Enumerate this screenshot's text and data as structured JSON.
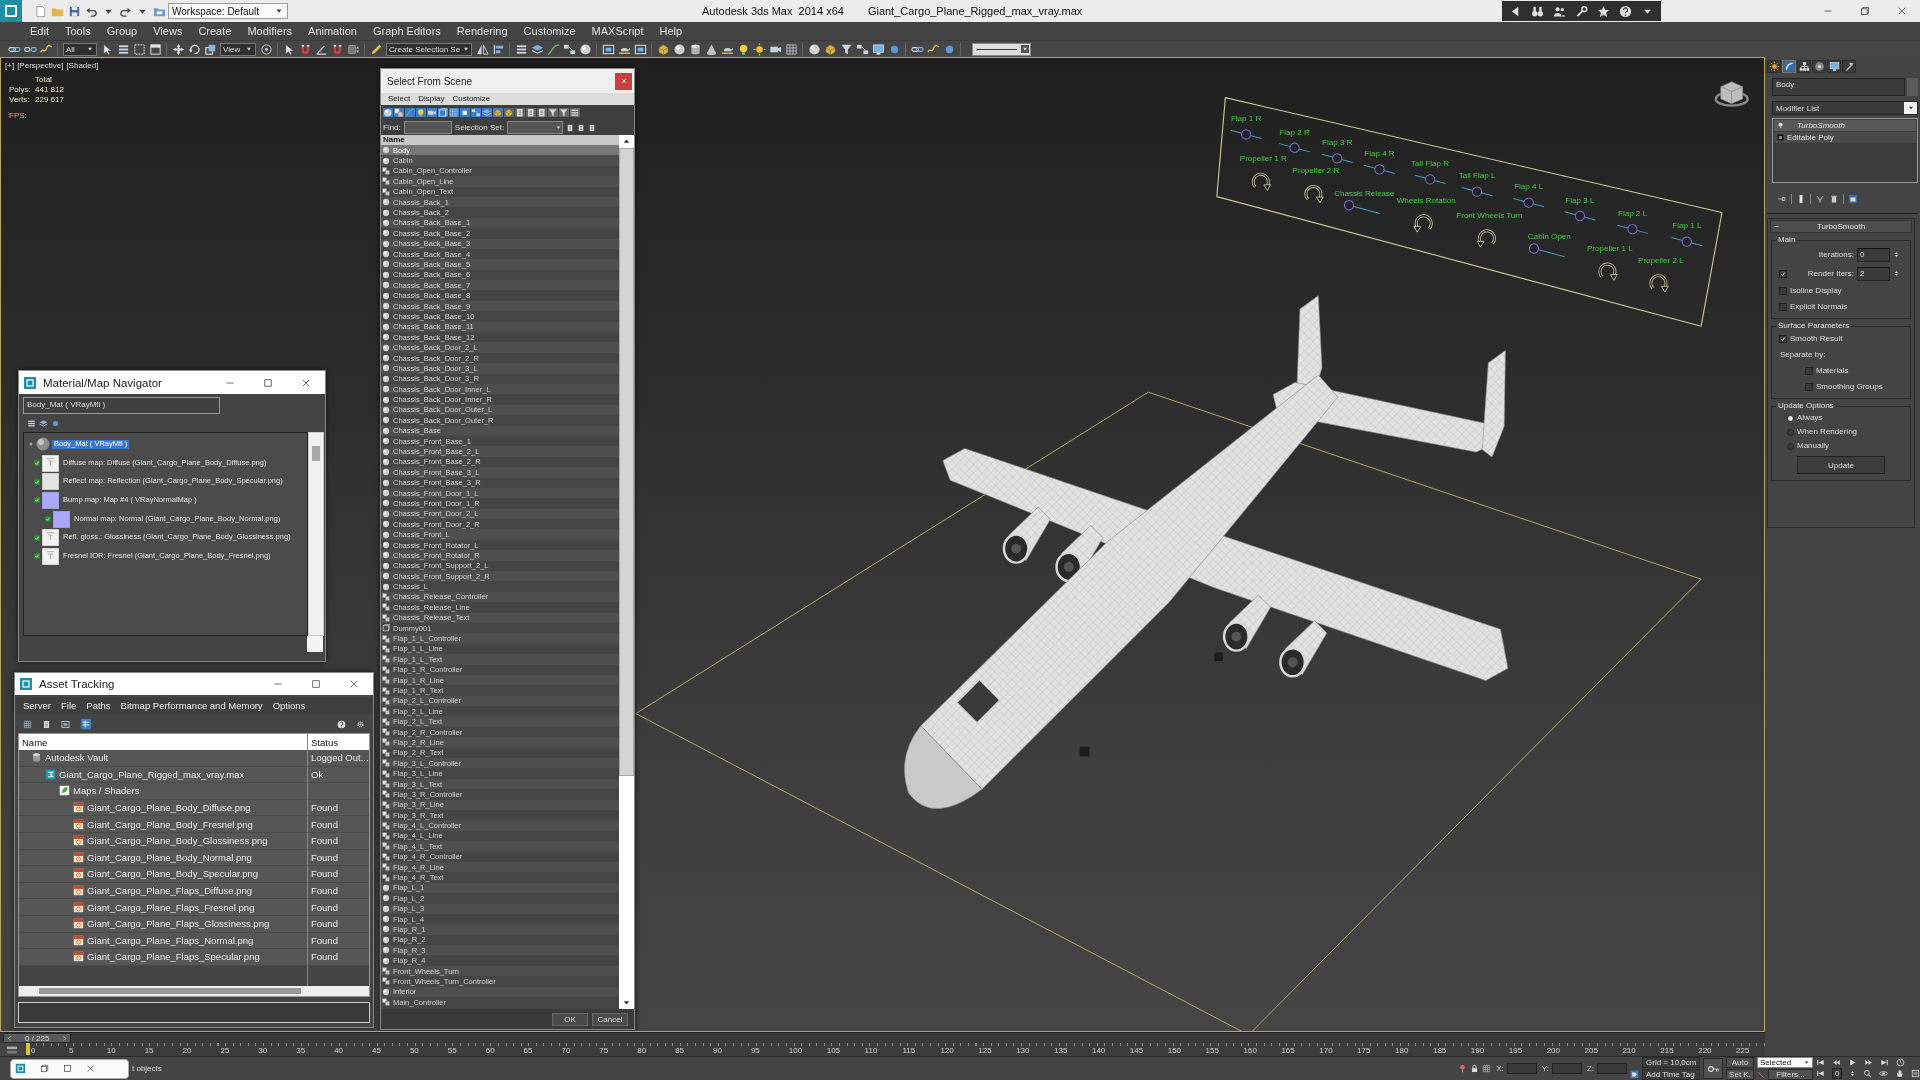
{
  "title_bar": {
    "workspace": "Workspace: Default",
    "app_title": "Autodesk 3ds Max  2014 x64",
    "file_name": "Giant_Cargo_Plane_Rigged_max_vray.max"
  },
  "menu": [
    "Edit",
    "Tools",
    "Group",
    "Views",
    "Create",
    "Modifiers",
    "Animation",
    "Graph Editors",
    "Rendering",
    "Customize",
    "MAXScript",
    "Help"
  ],
  "toolbar": {
    "selection_filter": "All",
    "reference_coordinate": "View",
    "named_selection": "Create Selection Se"
  },
  "viewport": {
    "menus": [
      "[+]",
      "[Perspective]",
      "[Shaded]"
    ],
    "stats_heading": "Total",
    "stats": [
      {
        "label": "Polys:",
        "value": "441 812"
      },
      {
        "label": "Verts:",
        "value": "229 617"
      }
    ],
    "fps_label": "FPS:"
  },
  "rig_controls": [
    {
      "label": "Flap 1 R",
      "kind": "slider",
      "level": 0.5
    },
    {
      "label": "Flap 2 R",
      "kind": "slider",
      "level": 0.5
    },
    {
      "label": "Flap 3 R",
      "kind": "slider",
      "level": 0.5
    },
    {
      "label": "Flap 4 R",
      "kind": "slider",
      "level": 0.5
    },
    {
      "label": "Propeller 1 R",
      "kind": "clockwise"
    },
    {
      "label": "Tail Flap R",
      "kind": "slider",
      "level": 0.5
    },
    {
      "label": "Propeller 2 R",
      "kind": "clockwise"
    },
    {
      "label": "Tail Flap L",
      "kind": "slider",
      "level": 0.5
    },
    {
      "label": "Flap 4 L",
      "kind": "slider",
      "level": 0.5
    },
    {
      "label": "Chassis Release",
      "kind": "slider",
      "level": 0
    },
    {
      "label": "Wheels Rotation",
      "kind": "counterclockwise"
    },
    {
      "label": "Flap 3 L",
      "kind": "slider",
      "level": 0.5
    },
    {
      "label": "Flap 2 L",
      "kind": "slider",
      "level": 0.5
    },
    {
      "label": "Front Wheels Turn",
      "kind": "counterclockwise"
    },
    {
      "label": "Flap 1 L",
      "kind": "slider",
      "level": 0.5
    },
    {
      "label": "Cabin Open",
      "kind": "slider",
      "level": 0
    },
    {
      "label": "Propeller 1 L",
      "kind": "clockwise"
    },
    {
      "label": "Propeller 2 L",
      "kind": "clockwise"
    }
  ],
  "material_navigator": {
    "title": "Material/Map Navigator",
    "field": "Body_Mat ( VRayMtl )",
    "tree": [
      {
        "label": "Body_Mat ( VRayMtl )",
        "kind": "material",
        "selected": true,
        "children": [
          {
            "label": "Diffuse map: Diffuse (Giant_Cargo_Plane_Body_Diffuse.png)",
            "kind": "bitmap",
            "selected": false
          },
          {
            "label": "Reflect map: Reflection (Giant_Cargo_Plane_Body_Specular.png)",
            "kind": "plain",
            "selected": false
          },
          {
            "label": "Bump map: Map #4 ( VRayNormalMap )",
            "kind": "normal",
            "selected": false,
            "children": [
              {
                "label": "Normal map: Normal (Giant_Cargo_Plane_Body_Normal.png)",
                "kind": "normal",
                "selected": false
              }
            ]
          },
          {
            "label": "Refl. gloss.: Glossiness (Giant_Cargo_Plane_Body_Glossiness.png)",
            "kind": "bitmap",
            "selected": false
          },
          {
            "label": "Fresnel IOR: Fresnel (Giant_Cargo_Plane_Body_Fresnel.png)",
            "kind": "bitmap",
            "selected": false
          }
        ]
      }
    ]
  },
  "asset_tracking": {
    "title": "Asset Tracking",
    "menu": [
      "Server",
      "File",
      "Paths",
      "Bitmap Performance and Memory",
      "Options"
    ],
    "columns": [
      "Name",
      "Status"
    ],
    "rows": [
      {
        "name": "Autodesk Vault",
        "status": "Logged Out...",
        "kind": "vault",
        "children": [
          {
            "name": "Giant_Cargo_Plane_Rigged_max_vray.max",
            "status": "Ok",
            "kind": "scene",
            "children": [
              {
                "name": "Maps / Shaders",
                "kind": "folder",
                "children": [
                  {
                    "name": "Giant_Cargo_Plane_Body_Diffuse.png",
                    "status": "Found",
                    "kind": "image"
                  },
                  {
                    "name": "Giant_Cargo_Plane_Body_Fresnel.png",
                    "status": "Found",
                    "kind": "image"
                  },
                  {
                    "name": "Giant_Cargo_Plane_Body_Glossiness.png",
                    "status": "Found",
                    "kind": "image"
                  },
                  {
                    "name": "Giant_Cargo_Plane_Body_Normal.png",
                    "status": "Found",
                    "kind": "image"
                  },
                  {
                    "name": "Giant_Cargo_Plane_Body_Specular.png",
                    "status": "Found",
                    "kind": "image"
                  },
                  {
                    "name": "Giant_Cargo_Plane_Flaps_Diffuse.png",
                    "status": "Found",
                    "kind": "image"
                  },
                  {
                    "name": "Giant_Cargo_Plane_Flaps_Fresnel.png",
                    "status": "Found",
                    "kind": "image"
                  },
                  {
                    "name": "Giant_Cargo_Plane_Flaps_Glossiness.png",
                    "status": "Found",
                    "kind": "image"
                  },
                  {
                    "name": "Giant_Cargo_Plane_Flaps_Normal.png",
                    "status": "Found",
                    "kind": "image"
                  },
                  {
                    "name": "Giant_Cargo_Plane_Flaps_Specular.png",
                    "status": "Found",
                    "kind": "image"
                  }
                ]
              }
            ]
          }
        ]
      }
    ]
  },
  "select_from_scene": {
    "title": "Select From Scene",
    "menu": [
      "Select",
      "Display",
      "Customize"
    ],
    "find_label": "Find:",
    "selection_set_label": "Selection Set:",
    "column": "Name",
    "rows": [
      {
        "name": "Body",
        "kind": "geometry",
        "selected": true
      },
      {
        "name": "Cabin",
        "kind": "geometry",
        "selected": false
      },
      {
        "name": "Cabin_Open_Controller",
        "kind": "shape",
        "selected": false
      },
      {
        "name": "Cabin_Open_Line",
        "kind": "shape",
        "selected": false
      },
      {
        "name": "Cabin_Open_Text",
        "kind": "shape",
        "selected": false
      },
      {
        "name": "Chassis_Back_1",
        "kind": "geometry",
        "selected": false
      },
      {
        "name": "Chassis_Back_2",
        "kind": "geometry",
        "selected": false
      },
      {
        "name": "Chassis_Back_Base_1",
        "kind": "geometry",
        "selected": false
      },
      {
        "name": "Chassis_Back_Base_2",
        "kind": "geometry",
        "selected": false
      },
      {
        "name": "Chassis_Back_Base_3",
        "kind": "geometry",
        "selected": false
      },
      {
        "name": "Chassis_Back_Base_4",
        "kind": "geometry",
        "selected": false
      },
      {
        "name": "Chassis_Back_Base_5",
        "kind": "geometry",
        "selected": false
      },
      {
        "name": "Chassis_Back_Base_6",
        "kind": "geometry",
        "selected": false
      },
      {
        "name": "Chassis_Back_Base_7",
        "kind": "geometry",
        "selected": false
      },
      {
        "name": "Chassis_Back_Base_8",
        "kind": "geometry",
        "selected": false
      },
      {
        "name": "Chassis_Back_Base_9",
        "kind": "geometry",
        "selected": false
      },
      {
        "name": "Chassis_Back_Base_10",
        "kind": "geometry",
        "selected": false
      },
      {
        "name": "Chassis_Back_Base_11",
        "kind": "geometry",
        "selected": false
      },
      {
        "name": "Chassis_Back_Base_12",
        "kind": "geometry",
        "selected": false
      },
      {
        "name": "Chassis_Back_Door_2_L",
        "kind": "geometry",
        "selected": false
      },
      {
        "name": "Chassis_Back_Door_2_R",
        "kind": "geometry",
        "selected": false
      },
      {
        "name": "Chassis_Back_Door_3_L",
        "kind": "geometry",
        "selected": false
      },
      {
        "name": "Chassis_Back_Door_3_R",
        "kind": "geometry",
        "selected": false
      },
      {
        "name": "Chassis_Back_Door_Inner_L",
        "kind": "geometry",
        "selected": false
      },
      {
        "name": "Chassis_Back_Door_Inner_R",
        "kind": "geometry",
        "selected": false
      },
      {
        "name": "Chassis_Back_Door_Outer_L",
        "kind": "geometry",
        "selected": false
      },
      {
        "name": "Chassis_Back_Door_Outer_R",
        "kind": "geometry",
        "selected": false
      },
      {
        "name": "Chassis_Base",
        "kind": "geometry",
        "selected": false
      },
      {
        "name": "Chassis_Front_Base_1",
        "kind": "geometry",
        "selected": false
      },
      {
        "name": "Chassis_Front_Base_2_L",
        "kind": "geometry",
        "selected": false
      },
      {
        "name": "Chassis_Front_Base_2_R",
        "kind": "geometry",
        "selected": false
      },
      {
        "name": "Chassis_Front_Base_3_L",
        "kind": "geometry",
        "selected": false
      },
      {
        "name": "Chassis_Front_Base_3_R",
        "kind": "geometry",
        "selected": false
      },
      {
        "name": "Chassis_Front_Door_1_L",
        "kind": "geometry",
        "selected": false
      },
      {
        "name": "Chassis_Front_Door_1_R",
        "kind": "geometry",
        "selected": false
      },
      {
        "name": "Chassis_Front_Door_2_L",
        "kind": "geometry",
        "selected": false
      },
      {
        "name": "Chassis_Front_Door_2_R",
        "kind": "geometry",
        "selected": false
      },
      {
        "name": "Chassis_Front_L",
        "kind": "geometry",
        "selected": false
      },
      {
        "name": "Chassis_Front_Rotator_L",
        "kind": "geometry",
        "selected": false
      },
      {
        "name": "Chassis_Front_Rotator_R",
        "kind": "geometry",
        "selected": false
      },
      {
        "name": "Chassis_Front_Support_2_L",
        "kind": "geometry",
        "selected": false
      },
      {
        "name": "Chassis_Front_Support_2_R",
        "kind": "geometry",
        "selected": false
      },
      {
        "name": "Chassis_L",
        "kind": "geometry",
        "selected": false
      },
      {
        "name": "Chassis_Release_Controller",
        "kind": "shape",
        "selected": false
      },
      {
        "name": "Chassis_Release_Line",
        "kind": "shape",
        "selected": false
      },
      {
        "name": "Chassis_Release_Text",
        "kind": "shape",
        "selected": false
      },
      {
        "name": "Dummy001",
        "kind": "helper",
        "selected": false
      },
      {
        "name": "Flap_1_L_Controller",
        "kind": "shape",
        "selected": false
      },
      {
        "name": "Flap_1_L_Line",
        "kind": "shape",
        "selected": false
      },
      {
        "name": "Flap_1_L_Text",
        "kind": "shape",
        "selected": false
      },
      {
        "name": "Flap_1_R_Controller",
        "kind": "shape",
        "selected": false
      },
      {
        "name": "Flap_1_R_Line",
        "kind": "shape",
        "selected": false
      },
      {
        "name": "Flap_1_R_Text",
        "kind": "shape",
        "selected": false
      },
      {
        "name": "Flap_2_L_Controller",
        "kind": "shape",
        "selected": false
      },
      {
        "name": "Flap_2_L_Line",
        "kind": "shape",
        "selected": false
      },
      {
        "name": "Flap_2_L_Text",
        "kind": "shape",
        "selected": false
      },
      {
        "name": "Flap_2_R_Controller",
        "kind": "shape",
        "selected": false
      },
      {
        "name": "Flap_2_R_Line",
        "kind": "shape",
        "selected": false
      },
      {
        "name": "Flap_2_R_Text",
        "kind": "shape",
        "selected": false
      },
      {
        "name": "Flap_3_L_Controller",
        "kind": "shape",
        "selected": false
      },
      {
        "name": "Flap_3_L_Line",
        "kind": "shape",
        "selected": false
      },
      {
        "name": "Flap_3_L_Text",
        "kind": "shape",
        "selected": false
      },
      {
        "name": "Flap_3_R_Controller",
        "kind": "shape",
        "selected": false
      },
      {
        "name": "Flap_3_R_Line",
        "kind": "shape",
        "selected": false
      },
      {
        "name": "Flap_3_R_Text",
        "kind": "shape",
        "selected": false
      },
      {
        "name": "Flap_4_L_Controller",
        "kind": "shape",
        "selected": false
      },
      {
        "name": "Flap_4_L_Line",
        "kind": "shape",
        "selected": false
      },
      {
        "name": "Flap_4_L_Text",
        "kind": "shape",
        "selected": false
      },
      {
        "name": "Flap_4_R_Controller",
        "kind": "shape",
        "selected": false
      },
      {
        "name": "Flap_4_R_Line",
        "kind": "shape",
        "selected": false
      },
      {
        "name": "Flap_4_R_Text",
        "kind": "shape",
        "selected": false
      },
      {
        "name": "Flap_L_1",
        "kind": "geometry",
        "selected": false
      },
      {
        "name": "Flap_L_2",
        "kind": "geometry",
        "selected": false
      },
      {
        "name": "Flap_L_3",
        "kind": "geometry",
        "selected": false
      },
      {
        "name": "Flap_L_4",
        "kind": "geometry",
        "selected": false
      },
      {
        "name": "Flap_R_1",
        "kind": "geometry",
        "selected": false
      },
      {
        "name": "Flap_R_2",
        "kind": "geometry",
        "selected": false
      },
      {
        "name": "Flap_R_3",
        "kind": "geometry",
        "selected": false
      },
      {
        "name": "Flap_R_4",
        "kind": "geometry",
        "selected": false
      },
      {
        "name": "Front_Wheels_Turn",
        "kind": "shape",
        "selected": false
      },
      {
        "name": "Front_Wheels_Turn_Controller",
        "kind": "shape",
        "selected": false
      },
      {
        "name": "Interior",
        "kind": "geometry",
        "selected": false
      },
      {
        "name": "Main_Controller",
        "kind": "shape",
        "selected": false
      }
    ],
    "buttons": [
      "OK",
      "Cancel"
    ]
  },
  "command_panel": {
    "tabs": [
      {
        "kind": "create",
        "selected": false
      },
      {
        "kind": "modify",
        "selected": true
      },
      {
        "kind": "hierarchy",
        "selected": false
      },
      {
        "kind": "motion",
        "selected": false
      },
      {
        "kind": "display",
        "selected": false
      },
      {
        "kind": "utilities",
        "selected": false
      }
    ],
    "object_name": "Body",
    "modifier_list": "Modifier List",
    "stack": [
      {
        "name": "TurboSmooth",
        "kind": "modifier",
        "off_in_viewport": true,
        "selected": true
      },
      {
        "name": "Editable Poly",
        "kind": "base",
        "off_in_viewport": false,
        "selected": false
      }
    ],
    "rollout": {
      "title": "TurboSmooth",
      "groups": [
        {
          "title": "Main",
          "items": [
            {
              "kind": "spinner",
              "label": "Iterations:",
              "value": "0"
            },
            {
              "kind": "toggle_spinner",
              "label": "Render Iters:",
              "value": "2",
              "checked": true
            },
            {
              "kind": "checkbox",
              "label": "Isoline Display",
              "checked": false
            },
            {
              "kind": "checkbox",
              "label": "Explicit Normals",
              "checked": false
            }
          ]
        },
        {
          "title": "Surface Parameters",
          "items": [
            {
              "kind": "checkbox",
              "label": "Smooth Result",
              "checked": true
            },
            {
              "kind": "heading",
              "label": "Separate by:",
              "children": [
                {
                  "kind": "checkbox",
                  "label": "Materials",
                  "checked": false
                },
                {
                  "kind": "checkbox",
                  "label": "Smoothing Groups",
                  "checked": false
                }
              ]
            }
          ]
        },
        {
          "title": "Update Options",
          "items": [
            {
              "kind": "radio",
              "label": "Always",
              "selected": true
            },
            {
              "kind": "radio",
              "label": "When Rendering",
              "selected": false
            },
            {
              "kind": "radio",
              "label": "Manually",
              "selected": false
            },
            {
              "kind": "button",
              "label": "Update"
            }
          ]
        }
      ]
    }
  },
  "timeline": {
    "frame": "0 / 225",
    "level": 0,
    "ticks": [
      "0",
      "5",
      "10",
      "15",
      "20",
      "25",
      "30",
      "35",
      "40",
      "45",
      "50",
      "55",
      "60",
      "65",
      "70",
      "75",
      "80",
      "85",
      "90",
      "95",
      "100",
      "105",
      "110",
      "115",
      "120",
      "125",
      "130",
      "135",
      "140",
      "145",
      "150",
      "155",
      "160",
      "165",
      "170",
      "175",
      "180",
      "185",
      "190",
      "195",
      "200",
      "205",
      "210",
      "215",
      "220",
      "225"
    ]
  },
  "status_bar": {
    "message": "t objects",
    "coordinates": [
      "X:",
      "Y:",
      "Z:"
    ],
    "grid": "Grid = 10,0cm",
    "add_time_tag": "Add Time Tag",
    "auto_key": "Auto",
    "set_key": "Set K.",
    "key_filter": "Selected",
    "filters": "Filters...",
    "current_frame": "0"
  }
}
